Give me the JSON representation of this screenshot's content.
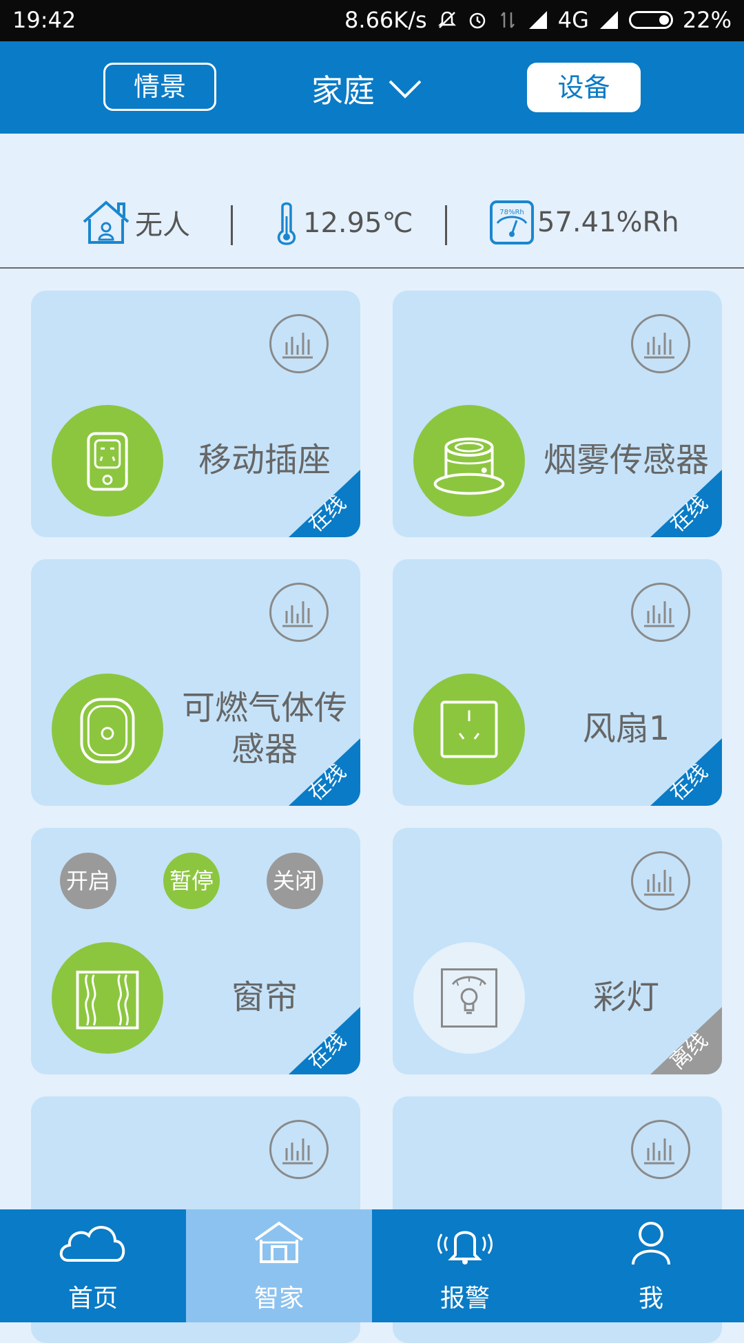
{
  "status_bar": {
    "time": "19:42",
    "net_speed": "8.66K/s",
    "network": "4G",
    "battery": "22%"
  },
  "header": {
    "scene_label": "情景",
    "home_label": "家庭",
    "device_label": "设备"
  },
  "env": {
    "presence": "无人",
    "temperature": "12.95℃",
    "humidity": "57.41%Rh",
    "hygrometer_face_text": "78%Rh"
  },
  "devices": [
    {
      "name": "移动插座",
      "status": "在线",
      "icon": "socket-icon"
    },
    {
      "name": "烟雾传感器",
      "status": "在线",
      "icon": "smoke-detector-icon"
    },
    {
      "name": "可燃气体传感器",
      "status": "在线",
      "icon": "gas-sensor-icon"
    },
    {
      "name": "风扇1",
      "status": "在线",
      "icon": "switch-panel-icon"
    },
    {
      "name": "窗帘",
      "status": "在线",
      "icon": "curtain-icon",
      "controls": [
        "开启",
        "暂停",
        "关闭"
      ],
      "active_control": "暂停"
    },
    {
      "name": "彩灯",
      "status": "离线",
      "icon": "light-switch-icon"
    }
  ],
  "colors": {
    "primary": "#0a7bc6",
    "online": "#0a7bc6",
    "offline": "#9a9a9a",
    "device_on": "#8cc63f",
    "card_bg": "#c5e2f8"
  },
  "nav": [
    {
      "label": "首页",
      "icon": "cloud-icon"
    },
    {
      "label": "智家",
      "icon": "home-icon",
      "active": true
    },
    {
      "label": "报警",
      "icon": "bell-icon"
    },
    {
      "label": "我",
      "icon": "user-icon"
    }
  ]
}
